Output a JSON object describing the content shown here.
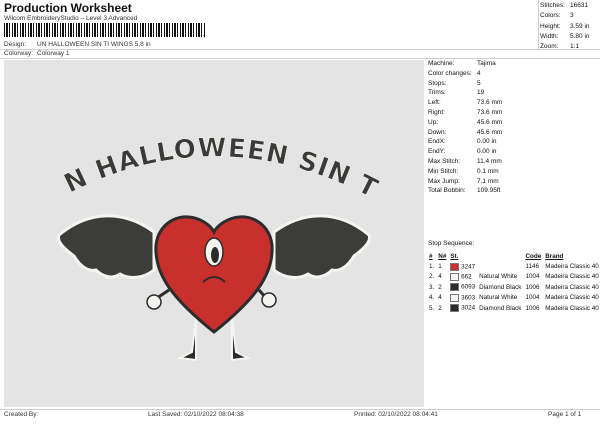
{
  "header": {
    "title": "Production Worksheet",
    "subtitle": "Wilcom EmbroideryStudio – Level 3 Advanced",
    "barcode_tail": ",",
    "design_label": "Design:",
    "design_value": "UN HALLOWEEN SIN TI WINGS 5,8 in",
    "colorway_label": "Colorway:",
    "colorway_value": "Colorway 1"
  },
  "stats": [
    {
      "label": "Stitches:",
      "value": "16631"
    },
    {
      "label": "Colors:",
      "value": "3"
    },
    {
      "label": "Height:",
      "value": "3.59 in"
    },
    {
      "label": "Width:",
      "value": "5.80 in"
    },
    {
      "label": "Zoom:",
      "value": "1:1"
    }
  ],
  "design": {
    "text": "UN HALLOWEEN SIN TI",
    "colors": {
      "red": "#c8302e",
      "black": "#2c2c2c",
      "wing": "#3c3c3a",
      "white": "#f4f4f0"
    }
  },
  "machine_info": [
    {
      "label": "Machine:",
      "value": "Tajima"
    },
    {
      "label": "Color changes:",
      "value": "4"
    },
    {
      "label": "Stops:",
      "value": "5"
    },
    {
      "label": "Trims:",
      "value": "19"
    },
    {
      "label": "Left:",
      "value": "73.6 mm"
    },
    {
      "label": "Right:",
      "value": "73.6 mm"
    },
    {
      "label": "Up:",
      "value": "45.6 mm"
    },
    {
      "label": "Down:",
      "value": "45.6 mm"
    },
    {
      "label": "EndX:",
      "value": "0.00 in"
    },
    {
      "label": "EndY:",
      "value": "0.00 in"
    },
    {
      "label": "Max Stitch:",
      "value": "11.4 mm"
    },
    {
      "label": "Min Stitch:",
      "value": "0.1 mm"
    },
    {
      "label": "Max Jump:",
      "value": "7.1 mm"
    },
    {
      "label": "Total Bobbin:",
      "value": "109.95ft"
    }
  ],
  "stop_sequence": {
    "heading": "Stop Sequence:",
    "columns": [
      "#",
      "N#",
      "St.",
      "Code",
      "Brand"
    ],
    "rows": [
      {
        "stop": "1.",
        "needle": "1",
        "swatch": "#c8302e",
        "stitches": "3247",
        "name": "",
        "code": "1146",
        "brand": "Madeira Classic 40"
      },
      {
        "stop": "2.",
        "needle": "4",
        "swatch": "#f4f4f0",
        "stitches": "662",
        "name": "Natural White",
        "code": "1004",
        "brand": "Madeira Classic 40"
      },
      {
        "stop": "3.",
        "needle": "2",
        "swatch": "#2c2c2c",
        "stitches": "6093",
        "name": "Diamond Black",
        "code": "1006",
        "brand": "Madeira Classic 40"
      },
      {
        "stop": "4.",
        "needle": "4",
        "swatch": "#f4f4f0",
        "stitches": "3603",
        "name": "Natural White",
        "code": "1004",
        "brand": "Madeira Classic 40"
      },
      {
        "stop": "5.",
        "needle": "2",
        "swatch": "#2c2c2c",
        "stitches": "3024",
        "name": "Diamond Black",
        "code": "1006",
        "brand": "Madeira Classic 40"
      }
    ]
  },
  "footer": {
    "created_by": "Created By:",
    "last_saved": "Last Saved: 02/10/2022 08:04:38",
    "printed": "Printed: 02/10/2022 08:04:41",
    "page": "Page 1 of 1"
  }
}
